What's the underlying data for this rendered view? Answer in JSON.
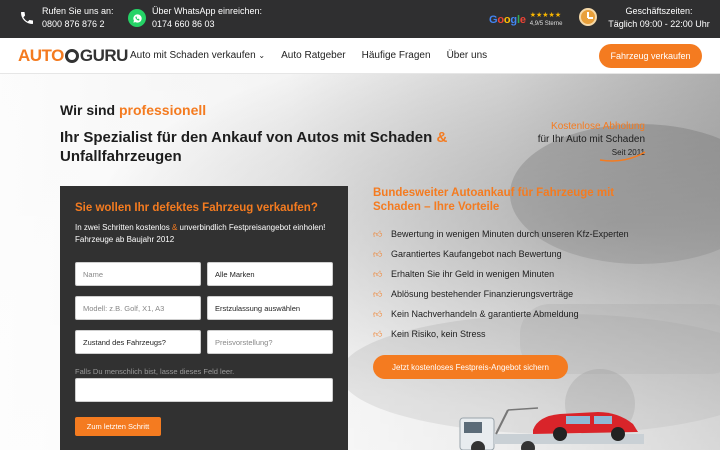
{
  "topbar": {
    "phone_label": "Rufen Sie uns an:",
    "phone_number": "0800 876 876 2",
    "whatsapp_label": "Über WhatsApp einreichen:",
    "whatsapp_number": "0174 660 86 03",
    "google_word": "Google",
    "google_stars": "★★★★★",
    "google_rating": "4,9/5 Sterne",
    "hours_label": "Geschäftszeiten:",
    "hours_value": "Täglich 09:00 - 22:00 Uhr"
  },
  "nav": {
    "logo_left": "AUTO",
    "logo_right": "GURU",
    "items": [
      {
        "label": "Auto mit Schaden verkaufen"
      },
      {
        "label": "Auto Ratgeber"
      },
      {
        "label": "Häufige Fragen"
      },
      {
        "label": "Über uns"
      }
    ],
    "cta": "Fahrzeug verkaufen"
  },
  "hero": {
    "kicker_prefix": "Wir sind ",
    "kicker_highlight": "professionell",
    "title_part1": "Ihr Spezialist für den Ankauf von Autos mit Schaden ",
    "title_amp": "&",
    "title_part2": " Unfallfahrzeugen",
    "badge_line1": "Kostenlose Abholung",
    "badge_line2": "für Ihr Auto mit Schaden",
    "badge_line3": "Seit 2011"
  },
  "form": {
    "title": "Sie wollen Ihr defektes Fahrzeug verkaufen?",
    "desc_part1": "In zwei Schritten kostenlos ",
    "desc_amp": "&",
    "desc_part2": " unverbindlich Festpreisangebot einholen! Fahrzeuge ab Baujahr 2012",
    "name_placeholder": "Name",
    "brand_select": "Alle Marken",
    "model_placeholder": "Modell: z.B. Golf, X1, A3",
    "registration_select": "Erstzulassung auswählen",
    "condition_select": "Zustand des Fahrzeugs?",
    "price_placeholder": "Preisvorstellung?",
    "honeypot_label": "Falls Du menschlich bist, lasse dieses Feld leer.",
    "submit": "Zum letzten Schritt"
  },
  "benefits": {
    "title": "Bundesweiter Autoankauf für Fahrzeuge mit Schaden – Ihre Vorteile",
    "items": [
      "Bewertung in wenigen Minuten durch unseren Kfz-Experten",
      "Garantiertes Kaufangebot nach Bewertung",
      "Erhalten Sie ihr Geld in wenigen Minuten",
      "Ablösung bestehender Finanzierungsverträge",
      "Kein Nachverhandeln & garantierte Abmeldung",
      "Kein Risiko, kein Stress"
    ],
    "cta": "Jetzt kostenloses Festpreis-Angebot sichern"
  },
  "colors": {
    "accent": "#f47b20",
    "topbar": "#2f2f30",
    "formbox": "#313131",
    "whatsapp": "#25d366"
  },
  "icons": [
    "phone-icon",
    "whatsapp-icon",
    "clock-icon",
    "chevron-down-icon",
    "thumbs-up-icon",
    "tow-truck-illustration"
  ]
}
